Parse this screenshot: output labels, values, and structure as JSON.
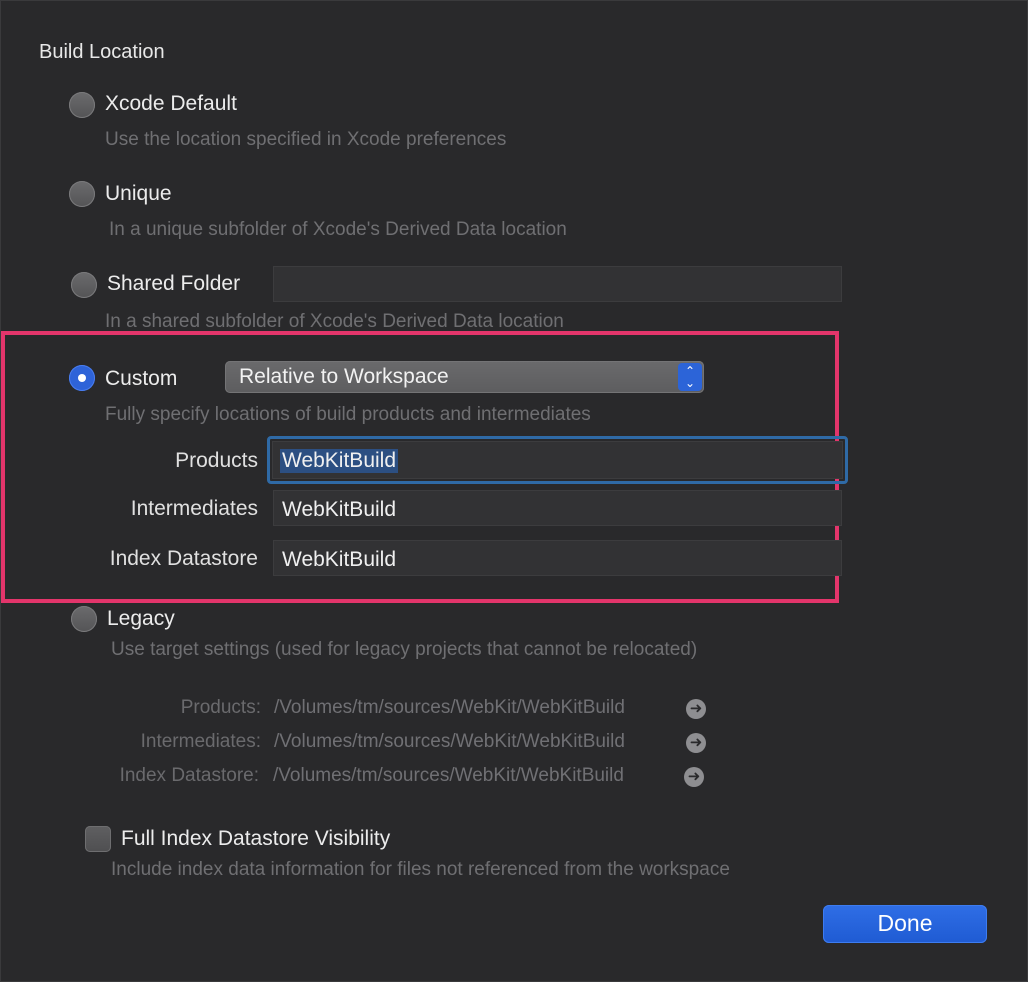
{
  "section_title": "Build Location",
  "options": {
    "xcode_default": {
      "label": "Xcode Default",
      "description": "Use the location specified in Xcode preferences"
    },
    "unique": {
      "label": "Unique",
      "description": "In a unique subfolder of Xcode's Derived Data location"
    },
    "shared_folder": {
      "label": "Shared Folder",
      "value": "",
      "description": "In a shared subfolder of Xcode's Derived Data location"
    },
    "custom": {
      "label": "Custom",
      "selected": true,
      "popup_value": "Relative to Workspace",
      "description": "Fully specify locations of build products and intermediates",
      "fields": {
        "products_label": "Products",
        "products_value": "WebKitBuild",
        "intermediates_label": "Intermediates",
        "intermediates_value": "WebKitBuild",
        "index_label": "Index Datastore",
        "index_value": "WebKitBuild"
      }
    },
    "legacy": {
      "label": "Legacy",
      "description": "Use target settings (used for legacy projects that cannot be relocated)",
      "paths": {
        "products_label": "Products:",
        "products_value": "/Volumes/tm/sources/WebKit/WebKitBuild",
        "intermediates_label": "Intermediates:",
        "intermediates_value": "/Volumes/tm/sources/WebKit/WebKitBuild",
        "index_label": "Index Datastore:",
        "index_value": "/Volumes/tm/sources/WebKit/WebKitBuild"
      }
    }
  },
  "index_visibility": {
    "label": "Full Index Datastore Visibility",
    "checked": false,
    "description": "Include index data information for files not referenced from the workspace"
  },
  "done_label": "Done",
  "colors": {
    "background": "#29292b",
    "accent": "#2e63d8",
    "highlight": "#e3356b"
  },
  "icons": {
    "popup": "up-down-chevron-icon",
    "reveal": "arrow-circle-right-icon"
  }
}
